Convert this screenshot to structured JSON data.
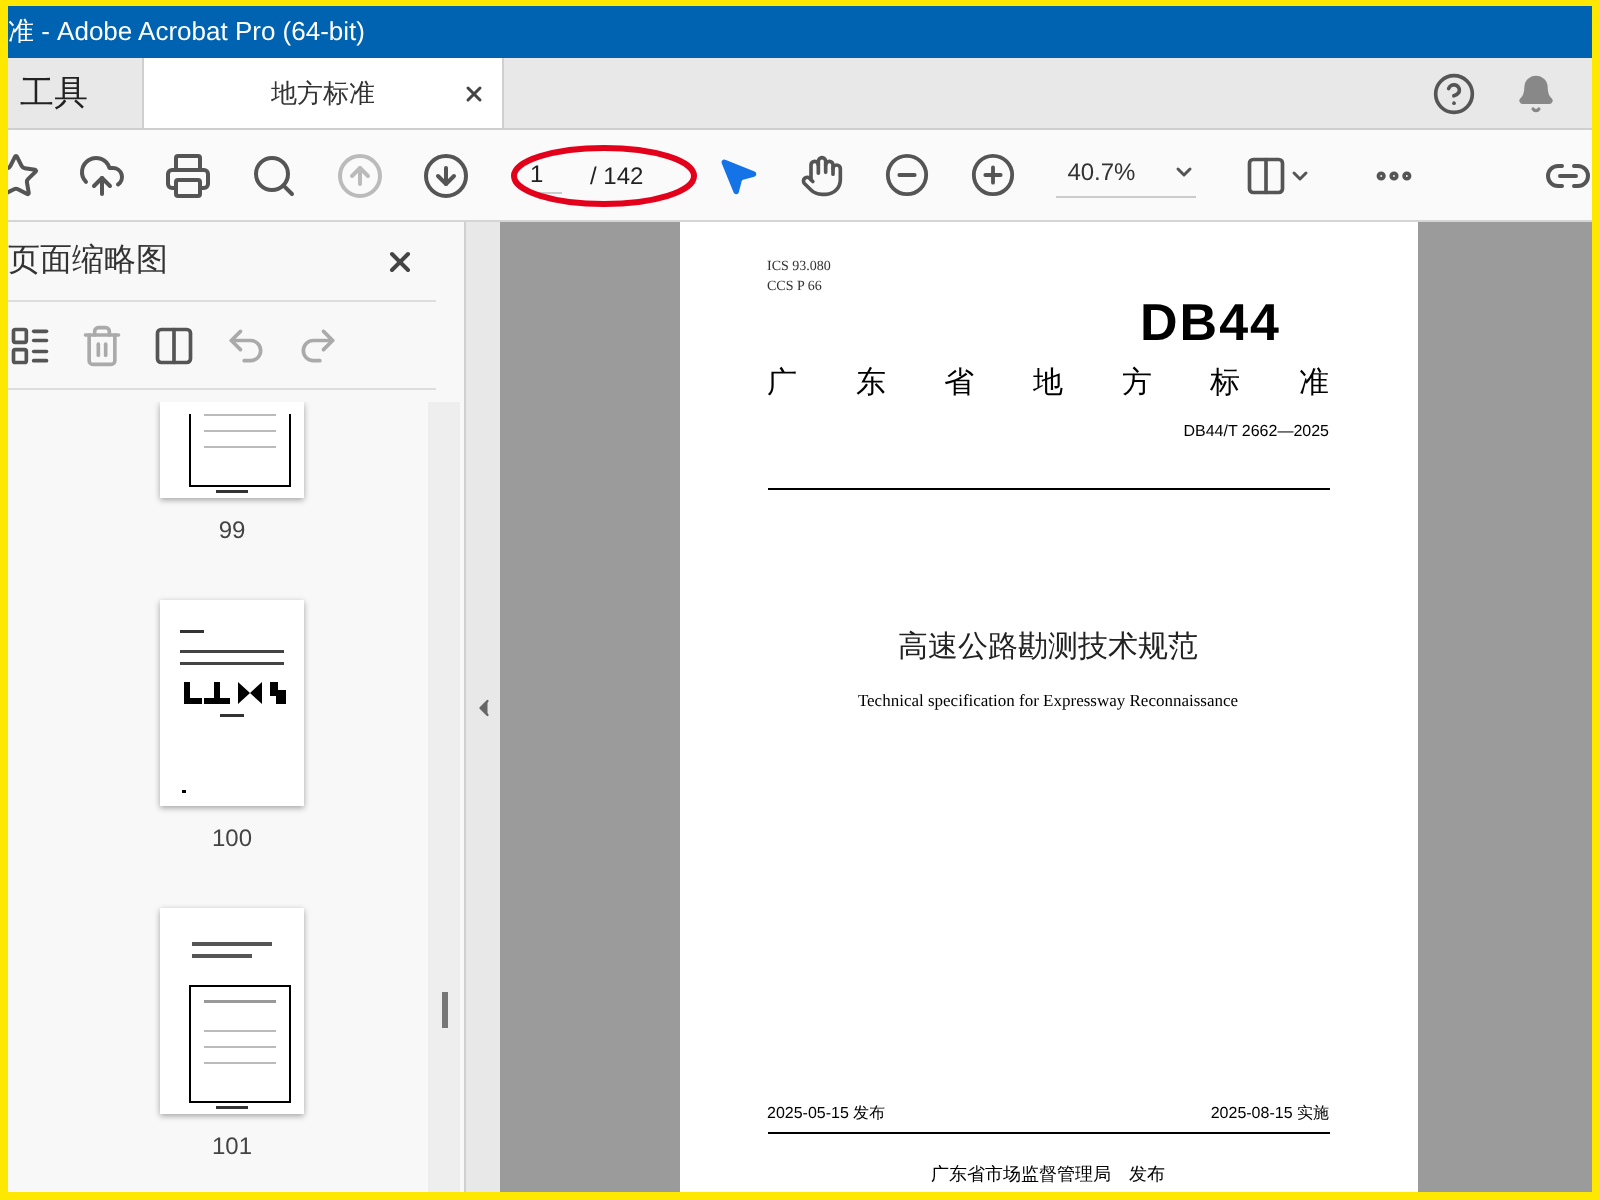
{
  "window": {
    "title": "准 - Adobe Acrobat Pro (64-bit)"
  },
  "tabs": [
    {
      "label": "工具",
      "selected": false,
      "closable": false
    },
    {
      "label": "地方标准",
      "selected": true,
      "closable": true
    }
  ],
  "toolbar": {
    "tools": [
      {
        "kind": "star",
        "disabled": false
      },
      {
        "kind": "upload",
        "disabled": false
      },
      {
        "kind": "print",
        "disabled": false
      },
      {
        "kind": "find",
        "disabled": false
      },
      {
        "kind": "prev",
        "disabled": true
      },
      {
        "kind": "next",
        "disabled": false
      }
    ],
    "page_field": {
      "value": "1",
      "total": "/ 142"
    },
    "modes": [
      {
        "kind": "select",
        "selected": true
      },
      {
        "kind": "hand",
        "selected": false
      }
    ],
    "zoom": "40.7%"
  },
  "sidebar": {
    "title": "页面缩略图",
    "tools": [
      {
        "kind": "options",
        "disabled": false
      },
      {
        "kind": "delete",
        "disabled": true
      },
      {
        "kind": "insert",
        "disabled": false
      },
      {
        "kind": "undo",
        "disabled": true
      },
      {
        "kind": "redo",
        "disabled": true
      }
    ],
    "thumbnails": [
      {
        "label": "99",
        "kind": "form",
        "selected": false
      },
      {
        "label": "100",
        "kind": "figures",
        "selected": false
      },
      {
        "label": "101",
        "kind": "form",
        "selected": false
      }
    ]
  },
  "document": {
    "ics": "ICS  93.080",
    "ccs": "CCS  P 66",
    "code": "DB44",
    "heading": [
      "广",
      "东",
      "省",
      "地",
      "方",
      "标",
      "准"
    ],
    "number": "DB44/T 2662—2025",
    "title": "高速公路勘测技术规范",
    "subtitle": "Technical specification for Expressway Reconnaissance",
    "issued": "2025-05-15 发布",
    "effective": "2025-08-15 实施",
    "publisher": "广东省市场监督管理局　发布"
  }
}
